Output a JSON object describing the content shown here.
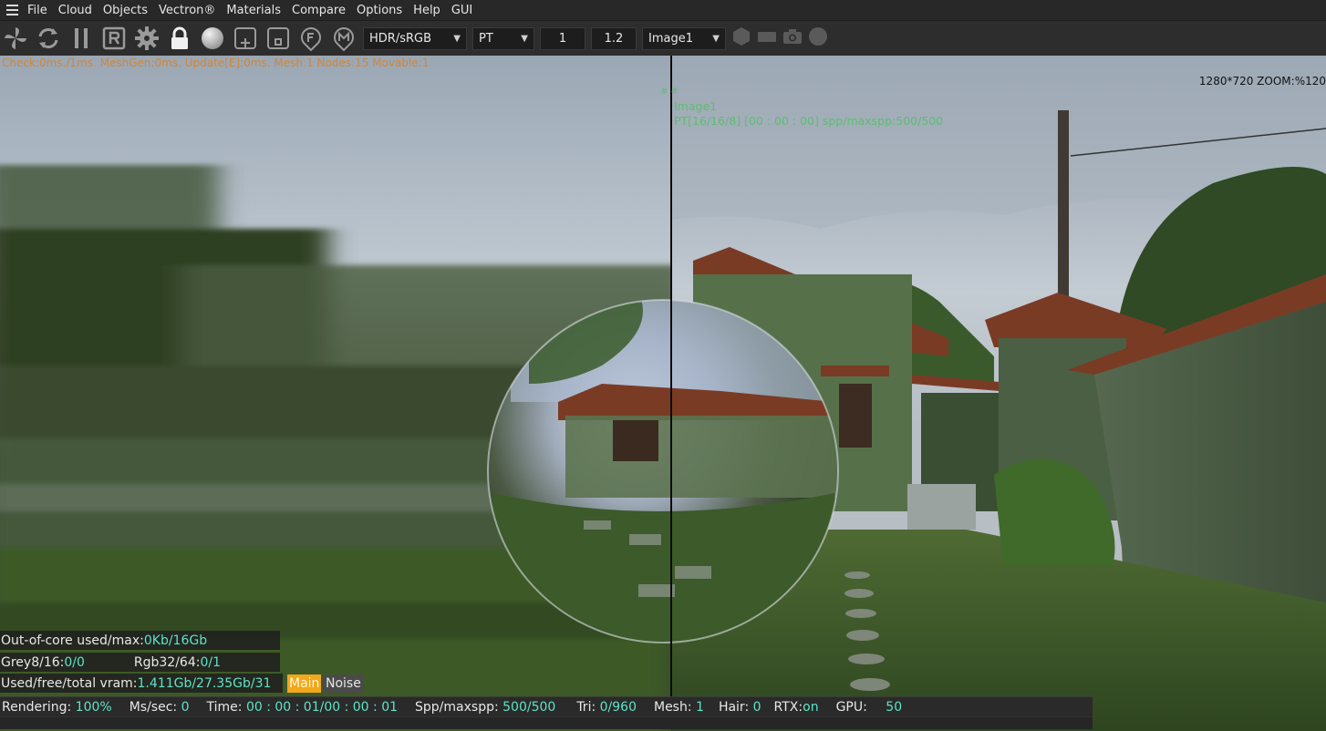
{
  "menu": {
    "items": [
      "File",
      "Cloud",
      "Objects",
      "Vectron®",
      "Materials",
      "Compare",
      "Options",
      "Help",
      "GUI"
    ]
  },
  "toolbar": {
    "icons": [
      "pinwheel-icon",
      "refresh-icon",
      "pause-icon",
      "render-r-icon",
      "gear-icon",
      "lock-icon",
      "sphere-icon",
      "add-object-icon",
      "object-square-icon",
      "material-f-icon",
      "material-m-icon"
    ],
    "tonemap_select": "HDR/sRGB",
    "engine_select": "PT",
    "value1": "1",
    "value2": "1.2",
    "image_select": "Image1",
    "extra_icons": [
      "hexagon-icon",
      "rectangle-icon",
      "camera-icon",
      "circle-icon"
    ]
  },
  "viewport": {
    "stats_top": "Check:0ms./1ms. MeshGen:0ms. Update[E]:0ms. Mesh:1 Nodes:15 Movable:1",
    "zoom_label": "1280*720 ZOOM:%120",
    "marker": "# #",
    "image_name": "Image1",
    "image_status": "PT[16/16/8] [00 : 00 : 00] spp/maxspp:500/500"
  },
  "info": {
    "out_of_core_label": "Out-of-core used/max:",
    "out_of_core_value": "0Kb/16Gb",
    "grey_label": "Grey8/16: ",
    "grey_value": "0/0",
    "rgb_label": "Rgb32/64: ",
    "rgb_value": "0/1",
    "vram_label": "Used/free/total vram: ",
    "vram_value": "1.411Gb/27.35Gb/31",
    "main_tag": "Main",
    "noise_tag": "Noise"
  },
  "status": {
    "rendering_label": "Rendering: ",
    "rendering_value": "100%",
    "ms_label": "Ms/sec: ",
    "ms_value": "0",
    "time_label": "Time: ",
    "time_value": "00 : 00 : 01/00 : 00 : 01",
    "spp_label": "Spp/maxspp: ",
    "spp_value": "500/500",
    "tri_label": "Tri: ",
    "tri_value": "0/960",
    "mesh_label": "Mesh: ",
    "mesh_value": "1",
    "hair_label": "Hair: ",
    "hair_value": "0",
    "rtx_label": "RTX:",
    "rtx_value": "on",
    "gpu_label": "GPU: ",
    "gpu_value": "50"
  }
}
